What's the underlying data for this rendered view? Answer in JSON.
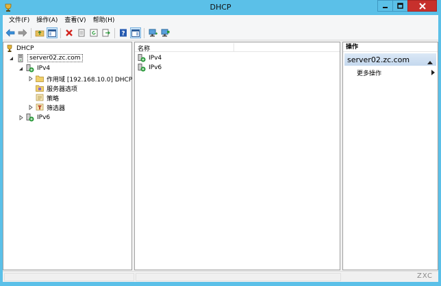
{
  "window": {
    "title": "DHCP"
  },
  "menu": [
    "文件(F)",
    "操作(A)",
    "查看(V)",
    "帮助(H)"
  ],
  "toolbar": {
    "buttons": [
      "back-icon",
      "forward-icon",
      "up-folder-icon",
      "console-tree-icon",
      "delete-icon",
      "properties-icon",
      "refresh-icon",
      "export-icon",
      "help-icon",
      "action-pane-icon",
      "server-add-icon",
      "server-remove-icon"
    ]
  },
  "tree": {
    "root": "DHCP",
    "server": "server02.zc.com",
    "ipv4": "IPv4",
    "scope": "作用域 [192.168.10.0] DHCP",
    "server_options": "服务器选项",
    "policies": "策略",
    "filters": "筛选器",
    "ipv6": "IPv6"
  },
  "list": {
    "column_name": "名称",
    "items": [
      "IPv4",
      "IPv6"
    ]
  },
  "actions": {
    "title": "操作",
    "group": "server02.zc.com",
    "more": "更多操作"
  },
  "watermark": "ZXC",
  "colors": {
    "titlebar": "#5bc0e8",
    "close": "#c7302c",
    "actions_group": "#c4d8ee"
  }
}
